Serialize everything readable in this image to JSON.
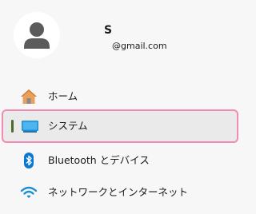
{
  "profile": {
    "name": "S",
    "email": "@gmail.com"
  },
  "nav": {
    "items": [
      {
        "label": "ホーム",
        "icon": "home-icon",
        "selected": false
      },
      {
        "label": "システム",
        "icon": "system-icon",
        "selected": true
      },
      {
        "label": "Bluetooth とデバイス",
        "icon": "bluetooth-icon",
        "selected": false
      },
      {
        "label": "ネットワークとインターネット",
        "icon": "network-icon",
        "selected": false
      }
    ]
  },
  "colors": {
    "background": "#f7f7f7",
    "selected_background": "#eaeaea",
    "selection_outline": "#f18bb6",
    "indicator": "#4d6a2a",
    "accent_blue": "#0067c0"
  }
}
